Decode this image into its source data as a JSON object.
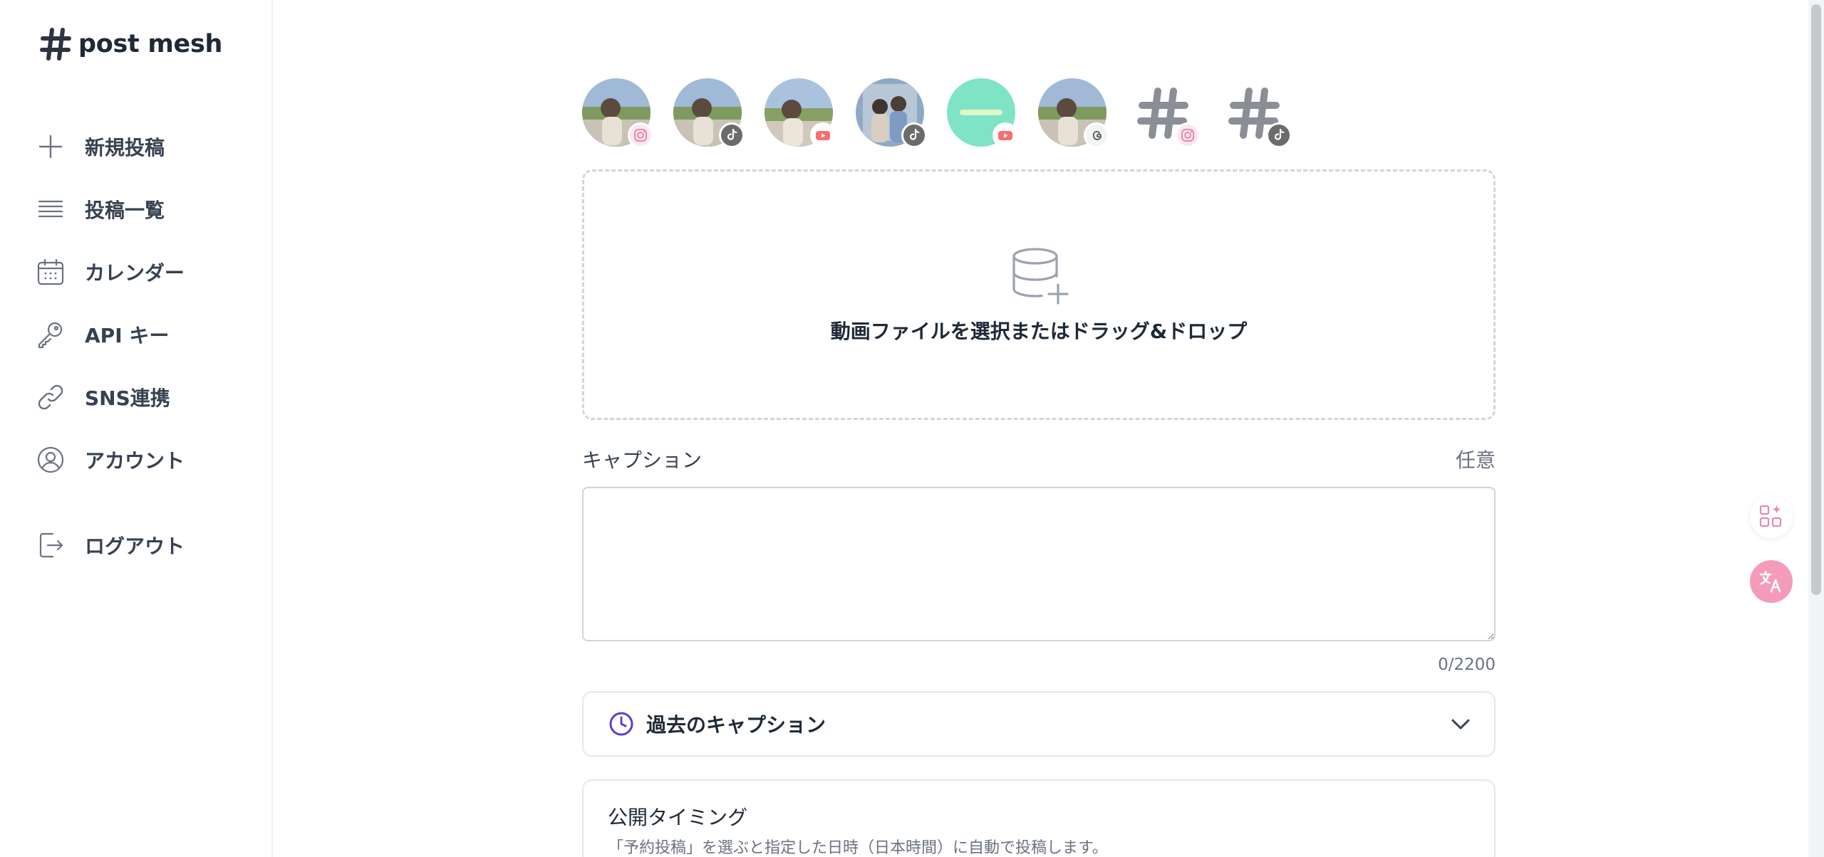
{
  "brand": {
    "name": "post mesh"
  },
  "sidebar": {
    "items": [
      {
        "label": "新規投稿",
        "icon": "plus-icon"
      },
      {
        "label": "投稿一覧",
        "icon": "list-icon"
      },
      {
        "label": "カレンダー",
        "icon": "calendar-icon"
      },
      {
        "label": "API キー",
        "icon": "key-icon"
      },
      {
        "label": "SNS連携",
        "icon": "link-icon"
      },
      {
        "label": "アカウント",
        "icon": "user-circle-icon"
      },
      {
        "label": "ログアウト",
        "icon": "logout-icon"
      }
    ]
  },
  "accounts": [
    {
      "platform": "instagram",
      "avatar": "photo"
    },
    {
      "platform": "tiktok",
      "avatar": "photo"
    },
    {
      "platform": "youtube",
      "avatar": "photo"
    },
    {
      "platform": "tiktok",
      "avatar": "photo-pair"
    },
    {
      "platform": "youtube",
      "avatar": "mint"
    },
    {
      "platform": "threads",
      "avatar": "photo"
    },
    {
      "platform": "instagram",
      "avatar": "hash"
    },
    {
      "platform": "tiktok",
      "avatar": "hash"
    }
  ],
  "upload": {
    "text": "動画ファイルを選択またはドラッグ&ドロップ"
  },
  "caption": {
    "label": "キャプション",
    "optional": "任意",
    "value": "",
    "counter": "0/2200"
  },
  "past_captions": {
    "label": "過去のキャプション"
  },
  "timing": {
    "title": "公開タイミング",
    "description": "「予約投稿」を選ぶと指定した日時（日本時間）に自動で投稿します。"
  },
  "colors": {
    "accent_purple": "#5b3fd1",
    "pink": "#f49bb8",
    "mint": "#7fe3c6",
    "text": "#1f2937"
  }
}
